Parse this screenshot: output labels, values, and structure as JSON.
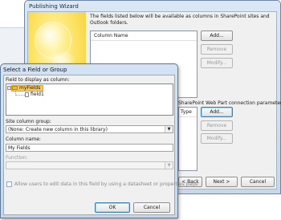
{
  "wizard": {
    "title": "Publishing Wizard",
    "description": "The fields listed below will be available as columns in SharePoint sites and Outlook folders.",
    "column_header": "Column Name",
    "buttons": {
      "add": "Add...",
      "remove": "Remove",
      "modify": "Modify..."
    },
    "lower_text": "SharePoint Web Part connection parameters.",
    "lower_label": "Type",
    "lower_buttons": {
      "add": "Add...",
      "remove": "Remove",
      "modify": "Modify..."
    },
    "nav": {
      "back": "< Back",
      "next": "Next >",
      "cancel": "Cancel"
    }
  },
  "dialog": {
    "title": "Select a Field or Group",
    "field_label": "Field to display as column:",
    "tree": {
      "root": "myFields",
      "child": "field1"
    },
    "site_column_group_label": "Site column group:",
    "site_column_group_value": "(None: Create new column in this library)",
    "column_name_label": "Column name:",
    "column_name_value": "My Fields",
    "function_label": "Function:",
    "function_value": "",
    "checkbox_label": "Allow users to edit data in this field by using a datasheet or properties page",
    "ok": "OK",
    "cancel": "Cancel"
  },
  "colors": {
    "title_bar": "#dbe7f4",
    "tree_selection": "#f6c85e",
    "wizard_art": "#fde46a"
  }
}
